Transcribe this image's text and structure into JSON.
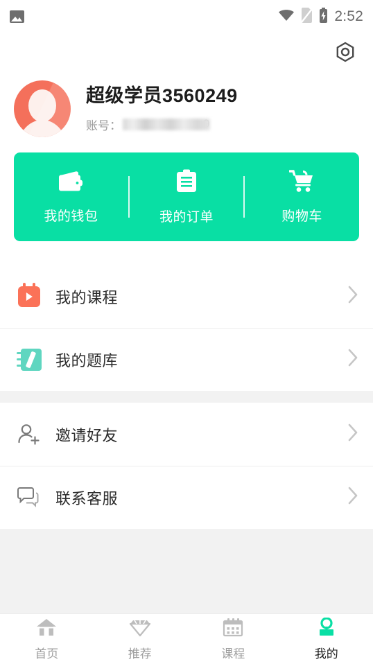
{
  "status_bar": {
    "left_icon": "image-icon",
    "icons": [
      "wifi-icon",
      "sim-card-off-icon",
      "battery-charging-icon"
    ],
    "time": "2:52"
  },
  "header": {
    "settings_icon": "settings-gear-icon"
  },
  "profile": {
    "avatar_icon": "user-avatar",
    "name": "超级学员3560249",
    "account_label": "账号：",
    "account_value_masked": "",
    "account_tail": "9",
    "accent_color": "#f4705b"
  },
  "quick_actions": {
    "background_color": "#09dfa4",
    "items": [
      {
        "icon": "wallet-icon",
        "label": "我的钱包"
      },
      {
        "icon": "clipboard-icon",
        "label": "我的订单"
      },
      {
        "icon": "cart-icon",
        "label": "购物车"
      }
    ]
  },
  "menu_group_1": [
    {
      "icon": "course-video-calendar-icon",
      "label": "我的课程",
      "chevron": "chevron-right-icon",
      "icon_color": "#fb7258"
    },
    {
      "icon": "notebook-pencil-icon",
      "label": "我的题库",
      "chevron": "chevron-right-icon",
      "icon_color": "#5fd6c0"
    }
  ],
  "menu_group_2": [
    {
      "icon": "person-add-icon",
      "label": "邀请好友",
      "chevron": "chevron-right-icon",
      "icon_color": "#7a7a7a"
    },
    {
      "icon": "chat-bubbles-icon",
      "label": "联系客服",
      "chevron": "chevron-right-icon",
      "icon_color": "#7a7a7a"
    }
  ],
  "bottom_nav": {
    "active_color": "#09dfa4",
    "items": [
      {
        "icon": "home-icon",
        "label": "首页",
        "active": false
      },
      {
        "icon": "diamond-icon",
        "label": "推荐",
        "active": false
      },
      {
        "icon": "calendar-icon",
        "label": "课程",
        "active": false
      },
      {
        "icon": "person-icon",
        "label": "我的",
        "active": true
      }
    ]
  }
}
